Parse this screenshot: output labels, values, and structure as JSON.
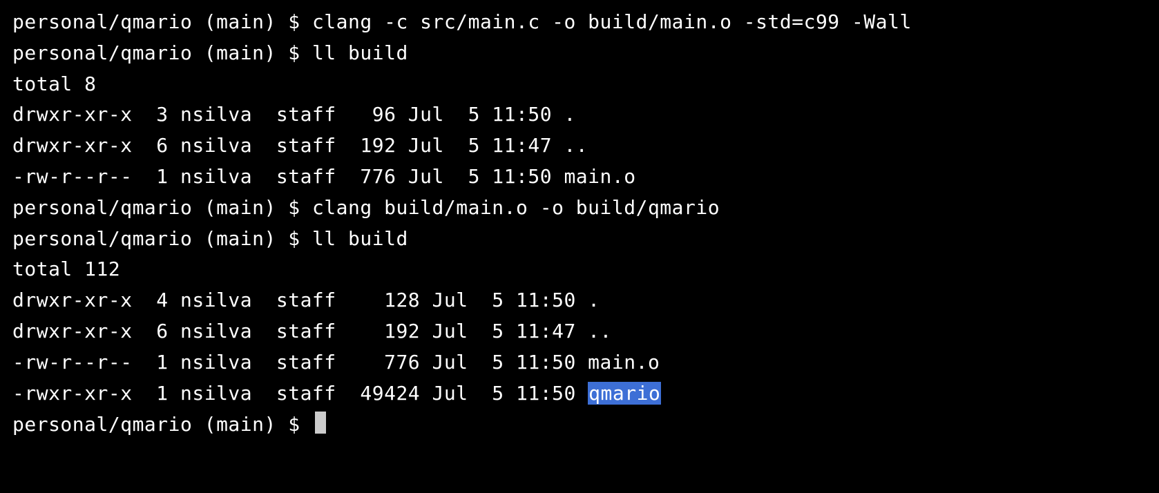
{
  "prompt": "personal/qmario (main) $ ",
  "commands": {
    "cmd1": "clang -c src/main.c -o build/main.o -std=c99 -Wall",
    "cmd2": "ll build",
    "cmd3": "clang build/main.o -o build/qmario",
    "cmd4": "ll build"
  },
  "listing1": {
    "total": "total 8",
    "rows": [
      "drwxr-xr-x  3 nsilva  staff   96 Jul  5 11:50 .",
      "drwxr-xr-x  6 nsilva  staff  192 Jul  5 11:47 ..",
      "-rw-r--r--  1 nsilva  staff  776 Jul  5 11:50 main.o"
    ]
  },
  "listing2": {
    "total": "total 112",
    "rows": [
      "drwxr-xr-x  4 nsilva  staff    128 Jul  5 11:50 .",
      "drwxr-xr-x  6 nsilva  staff    192 Jul  5 11:47 ..",
      "-rw-r--r--  1 nsilva  staff    776 Jul  5 11:50 main.o"
    ],
    "last_row_prefix": "-rwxr-xr-x  1 nsilva  staff  49424 Jul  5 11:50 ",
    "last_row_highlight": "qmario"
  }
}
